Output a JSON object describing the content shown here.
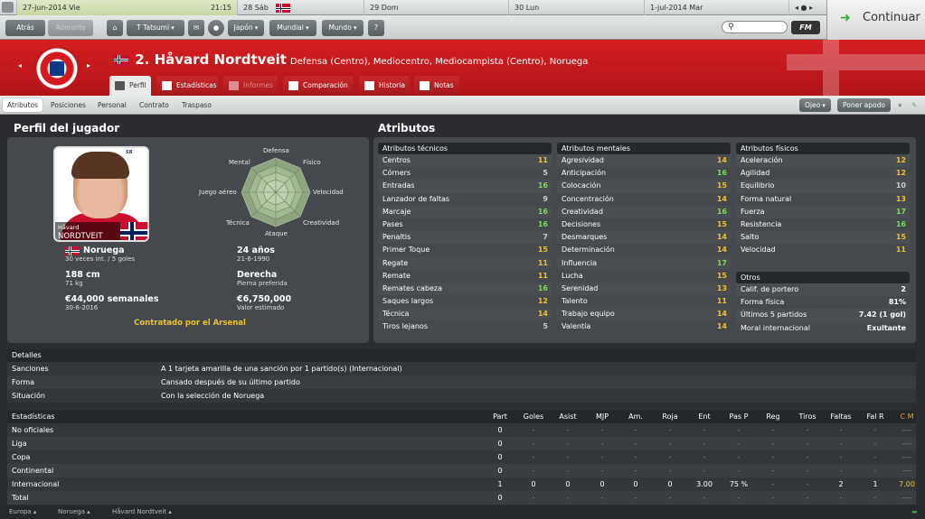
{
  "calendar": {
    "date": "27-jun-2014 Vie",
    "time": "21:15",
    "days": [
      "28 Sáb",
      "29 Dom",
      "30 Lun",
      "1-jul-2014 Mar"
    ],
    "nav": "◂ ● ▸"
  },
  "toolbar": {
    "back": "Atrás",
    "forward": "Adelante",
    "manager": "T Tatsumi",
    "menus": [
      "Japón",
      "Mundial",
      "Mundo"
    ],
    "help": "?",
    "search_placeholder": "",
    "fm": "FM",
    "continue": "Continuar"
  },
  "player": {
    "name": "2. Håvard Nordtveit",
    "positions": "Defensa (Centro), Mediocentro, Mediocampista (Centro), Noruega",
    "photo_name_1": "Håvard",
    "photo_name_2": "NORDTVEIT",
    "nation": "Noruega",
    "caps": "30 veces int. / 5 goles",
    "age": "24 años",
    "dob": "21-6-1990",
    "height": "188 cm",
    "weight": "71 kg",
    "foot": "Derecha",
    "foot_label": "Pierna preferida",
    "wage": "€44,000 semanales",
    "contract_end": "30-6-2016",
    "value": "€6,750,000",
    "value_label": "Valor estimado",
    "contract_status": "Contratado por el Arsenal"
  },
  "tabs": [
    "Perfil",
    "Estadísticas",
    "Informes",
    "Comparación",
    "Historia",
    "Notas"
  ],
  "subnav": {
    "items": [
      "Atributos",
      "Posiciones",
      "Personal",
      "Contrato",
      "Traspaso"
    ],
    "scout": "Ojeo",
    "nickname": "Poner apodo"
  },
  "profile": {
    "title": "Perfil del jugador",
    "radar_labels": [
      "Defensa",
      "Físico",
      "Velocidad",
      "Creatividad",
      "Ataque",
      "Técnica",
      "Juego aéreo",
      "Mental"
    ]
  },
  "attributes": {
    "title": "Atributos",
    "technical": {
      "title": "Atributos técnicos",
      "items": [
        {
          "n": "Centros",
          "v": "11"
        },
        {
          "n": "Córners",
          "v": "5"
        },
        {
          "n": "Entradas",
          "v": "16"
        },
        {
          "n": "Lanzador de faltas",
          "v": "9"
        },
        {
          "n": "Marcaje",
          "v": "16"
        },
        {
          "n": "Pases",
          "v": "16"
        },
        {
          "n": "Penaltis",
          "v": "7"
        },
        {
          "n": "Primer Toque",
          "v": "15"
        },
        {
          "n": "Regate",
          "v": "11"
        },
        {
          "n": "Remate",
          "v": "11"
        },
        {
          "n": "Remates cabeza",
          "v": "16"
        },
        {
          "n": "Saques largos",
          "v": "12"
        },
        {
          "n": "Técnica",
          "v": "14"
        },
        {
          "n": "Tiros lejanos",
          "v": "5"
        }
      ]
    },
    "mental": {
      "title": "Atributos mentales",
      "items": [
        {
          "n": "Agresividad",
          "v": "14"
        },
        {
          "n": "Anticipación",
          "v": "16"
        },
        {
          "n": "Colocación",
          "v": "15"
        },
        {
          "n": "Concentración",
          "v": "14"
        },
        {
          "n": "Creatividad",
          "v": "16"
        },
        {
          "n": "Decisiones",
          "v": "15"
        },
        {
          "n": "Desmarques",
          "v": "14"
        },
        {
          "n": "Determinación",
          "v": "14"
        },
        {
          "n": "Influencia",
          "v": "17"
        },
        {
          "n": "Lucha",
          "v": "15"
        },
        {
          "n": "Serenidad",
          "v": "13"
        },
        {
          "n": "Talento",
          "v": "11"
        },
        {
          "n": "Trabajo equipo",
          "v": "14"
        },
        {
          "n": "Valentía",
          "v": "14"
        }
      ]
    },
    "physical": {
      "title": "Atributos físicos",
      "items": [
        {
          "n": "Aceleración",
          "v": "12"
        },
        {
          "n": "Agilidad",
          "v": "12"
        },
        {
          "n": "Equilibrio",
          "v": "10"
        },
        {
          "n": "Forma natural",
          "v": "13"
        },
        {
          "n": "Fuerza",
          "v": "17"
        },
        {
          "n": "Resistencia",
          "v": "16"
        },
        {
          "n": "Salto",
          "v": "15"
        },
        {
          "n": "Velocidad",
          "v": "11"
        }
      ]
    },
    "other": {
      "title": "Otros",
      "items": [
        {
          "n": "Calif. de portero",
          "v": "2"
        },
        {
          "n": "Forma física",
          "v": "81%"
        },
        {
          "n": "Últimos 5 partidos",
          "v": "7.42 (1 gol)"
        },
        {
          "n": "Moral internacional",
          "v": "Exultante"
        }
      ]
    }
  },
  "details": {
    "title": "Detalles",
    "rows": [
      {
        "k": "Sanciones",
        "v": "A 1 tarjeta amarilla de una sanción por 1 partido(s) (Internacional)"
      },
      {
        "k": "Forma",
        "v": "Cansado después de su último partido"
      },
      {
        "k": "Situación",
        "v": "Con la selección de Noruega"
      }
    ]
  },
  "stats": {
    "title": "Estadísticas",
    "columns": [
      "Part",
      "Goles",
      "Asist",
      "MJP",
      "Am.",
      "Roja",
      "Ent",
      "Pas P",
      "Reg",
      "Tiros",
      "Faltas",
      "Fal R",
      "C M"
    ],
    "rows": [
      {
        "label": "No oficiales",
        "cells": [
          "0",
          "-",
          "-",
          "-",
          "-",
          "-",
          "-",
          "-",
          "-",
          "-",
          "-",
          "-",
          "----"
        ]
      },
      {
        "label": "Liga",
        "cells": [
          "0",
          "-",
          "-",
          "-",
          "-",
          "-",
          "-",
          "-",
          "-",
          "-",
          "-",
          "-",
          "----"
        ]
      },
      {
        "label": "Copa",
        "cells": [
          "0",
          "-",
          "-",
          "-",
          "-",
          "-",
          "-",
          "-",
          "-",
          "-",
          "-",
          "-",
          "----"
        ]
      },
      {
        "label": "Continental",
        "cells": [
          "0",
          "-",
          "-",
          "-",
          "-",
          "-",
          "-",
          "-",
          "-",
          "-",
          "-",
          "-",
          "----"
        ]
      },
      {
        "label": "Internacional",
        "cells": [
          "1",
          "0",
          "0",
          "0",
          "0",
          "0",
          "3.00",
          "75 %",
          "-",
          "-",
          "2",
          "1",
          "7.00"
        ]
      },
      {
        "label": "Total",
        "cells": [
          "0",
          "-",
          "-",
          "-",
          "-",
          "-",
          "-",
          "-",
          "-",
          "-",
          "-",
          "-",
          "----"
        ]
      }
    ]
  },
  "footer": [
    "Europa ▴",
    "Noruega ▴",
    "Håvard Nordtveit ▴"
  ],
  "colors": {
    "green": "#7ed957",
    "yellow": "#f0c030",
    "red": "#c8102e",
    "header_red": "#c81a1d"
  }
}
